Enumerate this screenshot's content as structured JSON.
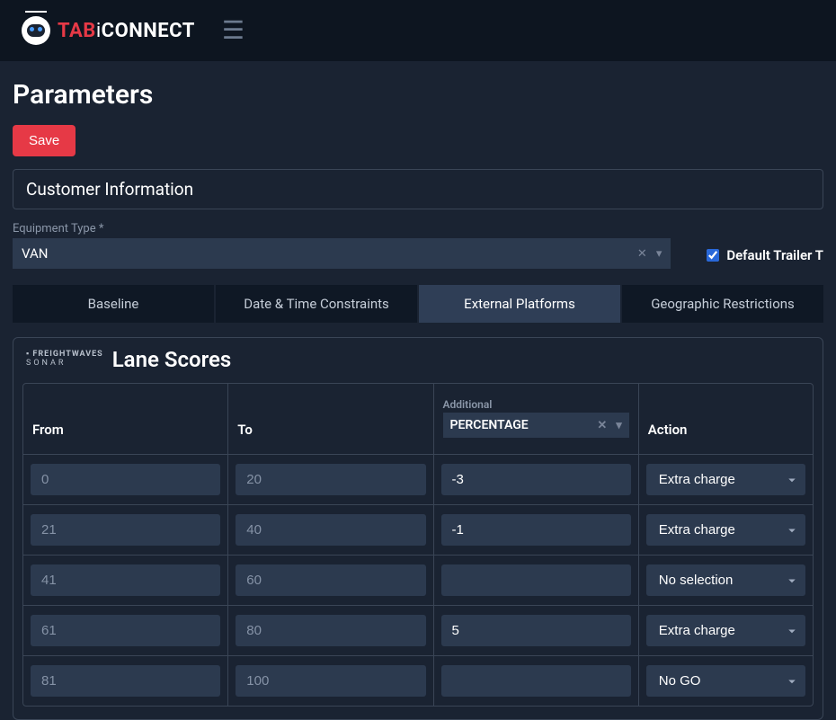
{
  "header": {
    "logo": {
      "tab": "TAB",
      "i": "i",
      "connect": "CONNECT"
    }
  },
  "page": {
    "title": "Parameters",
    "save_label": "Save",
    "section_customer_info": "Customer Information",
    "equipment_type_label": "Equipment Type *",
    "equipment_type_value": "VAN",
    "default_trailer_label": "Default Trailer T",
    "default_trailer_checked": true
  },
  "tabs": [
    {
      "label": "Baseline",
      "active": false
    },
    {
      "label": "Date & Time Constraints",
      "active": false
    },
    {
      "label": "External Platforms",
      "active": true
    },
    {
      "label": "Geographic Restrictions",
      "active": false
    }
  ],
  "lane_scores": {
    "title": "Lane Scores",
    "sonar_line1": "▪ FREIGHTWAVES",
    "sonar_line2": "SONAR",
    "columns": {
      "from": "From",
      "to": "To",
      "additional_label": "Additional",
      "additional_value": "PERCENTAGE",
      "action": "Action"
    },
    "action_options": [
      "No selection",
      "Extra charge",
      "No GO"
    ],
    "rows": [
      {
        "from_ph": "0",
        "to_ph": "20",
        "add_val": "-3",
        "action": "Extra charge"
      },
      {
        "from_ph": "21",
        "to_ph": "40",
        "add_val": "-1",
        "action": "Extra charge"
      },
      {
        "from_ph": "41",
        "to_ph": "60",
        "add_val": "",
        "action": "No selection"
      },
      {
        "from_ph": "61",
        "to_ph": "80",
        "add_val": "5",
        "action": "Extra charge"
      },
      {
        "from_ph": "81",
        "to_ph": "100",
        "add_val": "",
        "action": "No GO"
      }
    ]
  }
}
